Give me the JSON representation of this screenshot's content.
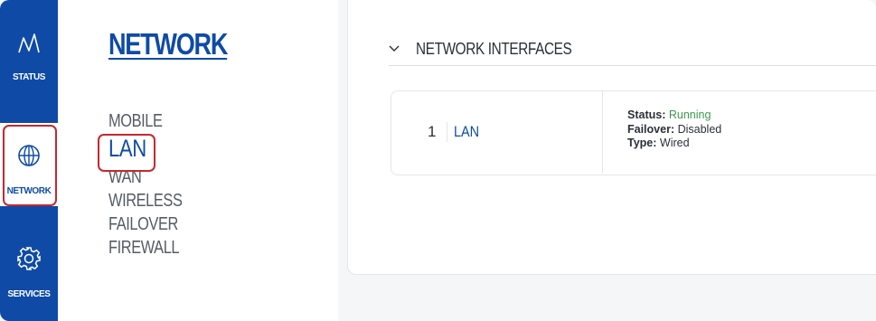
{
  "rail": {
    "status_label": "STATUS",
    "network_label": "NETWORK",
    "services_label": "SERVICES",
    "status_icon": "pulse-icon",
    "network_icon": "globe-icon",
    "services_icon": "gear-icon"
  },
  "menu": {
    "title": "NETWORK",
    "items": [
      "MOBILE",
      "LAN",
      "WAN",
      "WIRELESS",
      "FAILOVER",
      "FIREWALL"
    ],
    "active": "LAN"
  },
  "section": {
    "title": "NETWORK INTERFACES"
  },
  "interface": {
    "number": "1",
    "name": "LAN",
    "status_label": "Status:",
    "status_value": "Running",
    "failover_label": "Failover:",
    "failover_value": "Disabled",
    "type_label": "Type:",
    "type_value": "Wired"
  },
  "colors": {
    "brand": "#0f4ba6",
    "highlight": "#c5282f",
    "running": "#3a9a4c"
  }
}
